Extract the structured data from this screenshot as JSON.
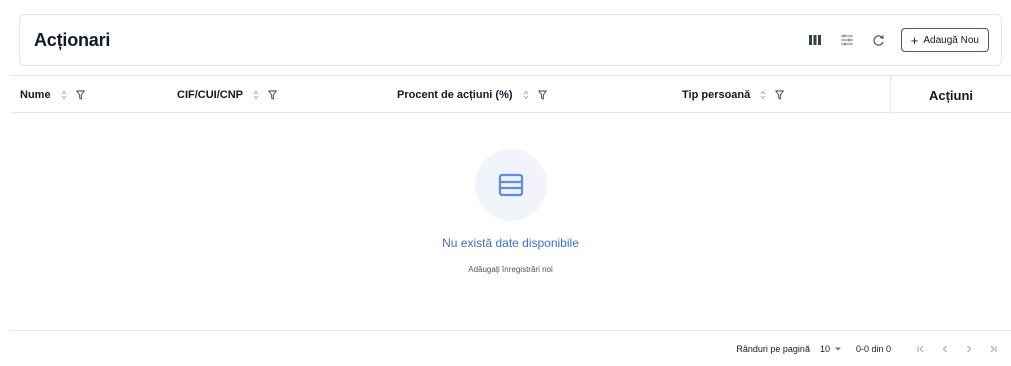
{
  "page": {
    "title": "Acționari"
  },
  "toolbar": {
    "columns_icon": "columns-icon",
    "filter_settings_icon": "sliders-icon",
    "refresh_icon": "refresh-icon",
    "add_label": "Adaugă Nou"
  },
  "table": {
    "columns": [
      {
        "label": "Nume"
      },
      {
        "label": "CIF/CUI/CNP"
      },
      {
        "label": "Procent de acțiuni (%)"
      },
      {
        "label": "Tip persoană"
      }
    ],
    "actions_label": "Acțiuni",
    "rows": []
  },
  "empty": {
    "title": "Nu există date disponibile",
    "subtitle": "Adăugați înregistrări noi"
  },
  "pagination": {
    "rows_per_page_label": "Rânduri pe pagină",
    "rows_per_page_value": "10",
    "range": "0-0 din 0"
  },
  "colors": {
    "accent": "#3b6fd4",
    "empty_icon": "#5b8def",
    "empty_bg": "#f1f5fb",
    "border": "#e5e7eb"
  }
}
